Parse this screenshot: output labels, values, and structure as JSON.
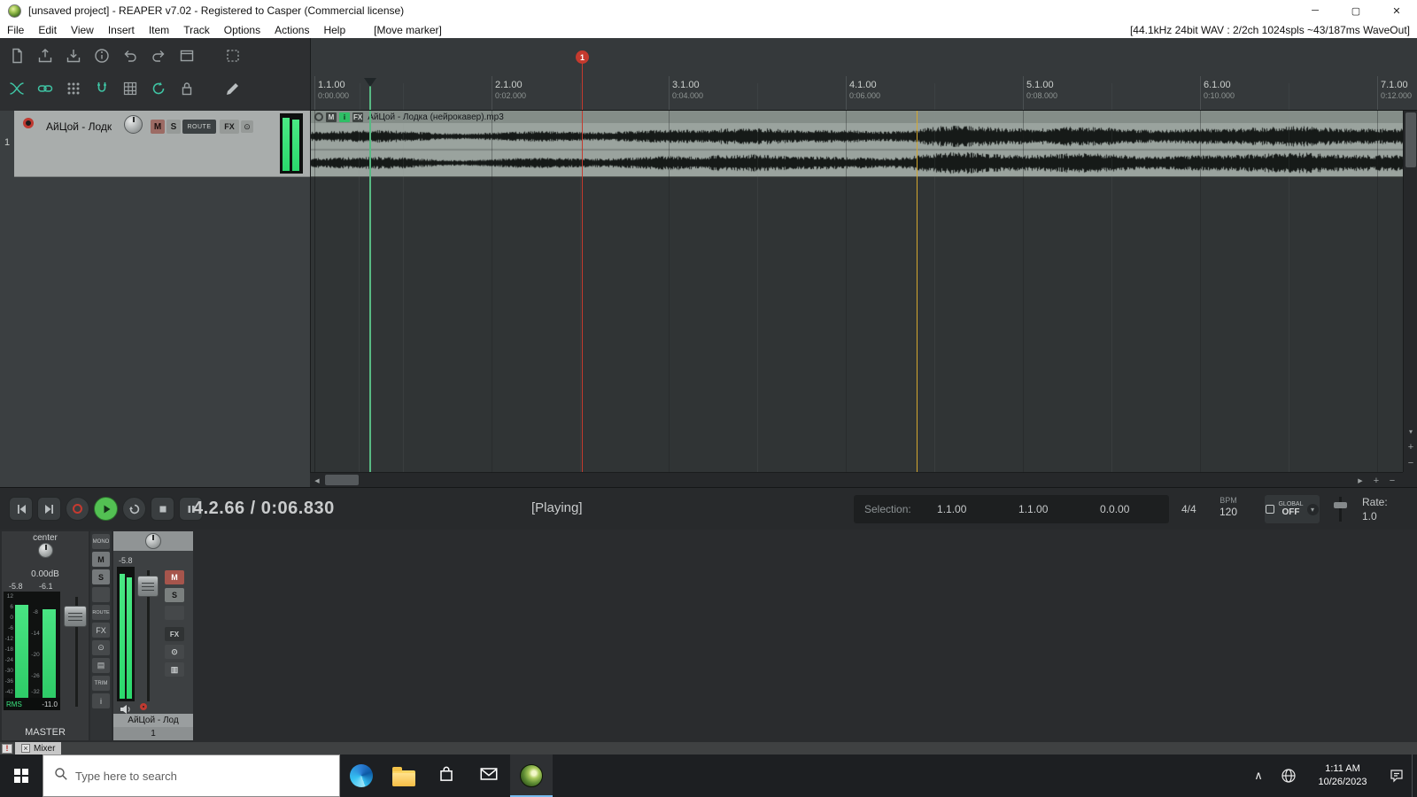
{
  "icons": {
    "minimize": "─",
    "maximize": "▢",
    "close": "✕",
    "scroll_left": "◀",
    "scroll_right": "▶",
    "zoom_in": "+",
    "zoom_out": "−",
    "caret_down": "▾",
    "chevron_up": "∧",
    "fx_enable": "⊙",
    "env_a": "▤",
    "env_b": "▥",
    "tab_close": "×"
  },
  "window": {
    "title": "[unsaved project] - REAPER v7.02 - Registered to Casper (Commercial license)"
  },
  "menubar": {
    "items": [
      "File",
      "Edit",
      "View",
      "Insert",
      "Item",
      "Track",
      "Options",
      "Actions",
      "Help",
      "[Move marker]"
    ],
    "audio_status": "[44.1kHz 24bit WAV : 2/2ch 1024spls ~43/187ms WaveOut]"
  },
  "ruler": {
    "marker_number": "1",
    "marks": [
      {
        "bar": "1.1.00",
        "time": "0:00.000"
      },
      {
        "bar": "2.1.00",
        "time": "0:02.000"
      },
      {
        "bar": "3.1.00",
        "time": "0:04.000"
      },
      {
        "bar": "4.1.00",
        "time": "0:06.000"
      },
      {
        "bar": "5.1.00",
        "time": "0:08.000"
      },
      {
        "bar": "6.1.00",
        "time": "0:10.000"
      },
      {
        "bar": "7.1.00",
        "time": "0:12.000"
      }
    ]
  },
  "track": {
    "number": "1",
    "name": "АйЦой - Лодк",
    "mute_label": "M",
    "solo_label": "S",
    "route_label": "ROUTE",
    "fx_label": "FX"
  },
  "item": {
    "label": "АйЦой - Лодка (нейрокавер).mp3",
    "mute_label": "M",
    "notes_label": "i",
    "fx_label": "FX"
  },
  "transport": {
    "position": "4.2.66 / 0:06.830",
    "status": "[Playing]",
    "selection_label": "Selection:",
    "selection_start": "1.1.00",
    "selection_end": "1.1.00",
    "selection_length": "0.0.00",
    "time_signature": "4/4",
    "bpm_label": "BPM",
    "bpm_value": "120",
    "global_label": "GLOBAL",
    "global_value": "OFF",
    "rate_label": "Rate:",
    "rate_value": "1.0"
  },
  "mixer": {
    "master": {
      "pan_label": "center",
      "gain_label": "0.00dB",
      "peak_left": "-5.8",
      "peak_right": "-6.1",
      "scale_left": [
        "12",
        "6",
        "0",
        "-6",
        "-12",
        "-18",
        "-24",
        "-30",
        "-36",
        "-42"
      ],
      "scale_mid": [
        "-8",
        "-14",
        "-20",
        "-26",
        "-32"
      ],
      "rms_label": "RMS",
      "rms_value": "-11.0",
      "name": "MASTER"
    },
    "util": {
      "mono": "MONO",
      "mute": "M",
      "solo": "S",
      "route": "ROUTE",
      "fx": "FX",
      "trim": "TRIM",
      "info": "i"
    },
    "track1": {
      "peak": "-5.8",
      "mute": "M",
      "solo": "S",
      "fx": "FX",
      "name": "АйЦой - Лод",
      "number": "1"
    }
  },
  "statusbar": {
    "warning": "!",
    "tab_label": "Mixer"
  },
  "taskbar": {
    "search_placeholder": "Type here to search",
    "time": "1:11 AM",
    "date": "10/26/2023"
  }
}
